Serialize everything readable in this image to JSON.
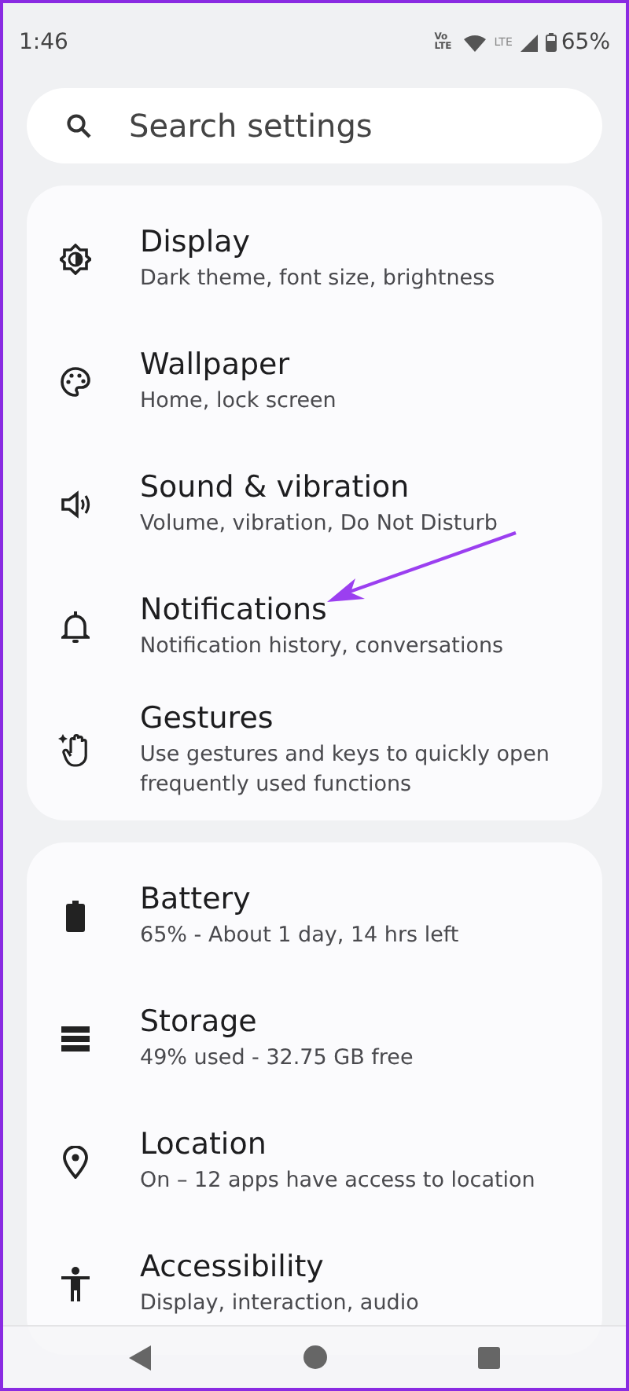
{
  "status_bar": {
    "time": "1:46",
    "volte": "Vo LTE",
    "lte": "LTE",
    "battery": "65%"
  },
  "search": {
    "placeholder": "Search settings"
  },
  "groups": [
    {
      "items": [
        {
          "title": "Display",
          "subtitle": "Dark theme, font size, brightness"
        },
        {
          "title": "Wallpaper",
          "subtitle": "Home, lock screen"
        },
        {
          "title": "Sound & vibration",
          "subtitle": "Volume, vibration, Do Not Disturb"
        },
        {
          "title": "Notifications",
          "subtitle": "Notification history, conversations"
        },
        {
          "title": "Gestures",
          "subtitle": "Use gestures and keys to quickly open frequently used functions"
        }
      ]
    },
    {
      "items": [
        {
          "title": "Battery",
          "subtitle": "65% - About 1 day, 14 hrs left"
        },
        {
          "title": "Storage",
          "subtitle": "49% used - 32.75 GB free"
        },
        {
          "title": "Location",
          "subtitle": "On – 12 apps have access to location"
        },
        {
          "title": "Accessibility",
          "subtitle": "Display, interaction, audio"
        }
      ]
    }
  ]
}
